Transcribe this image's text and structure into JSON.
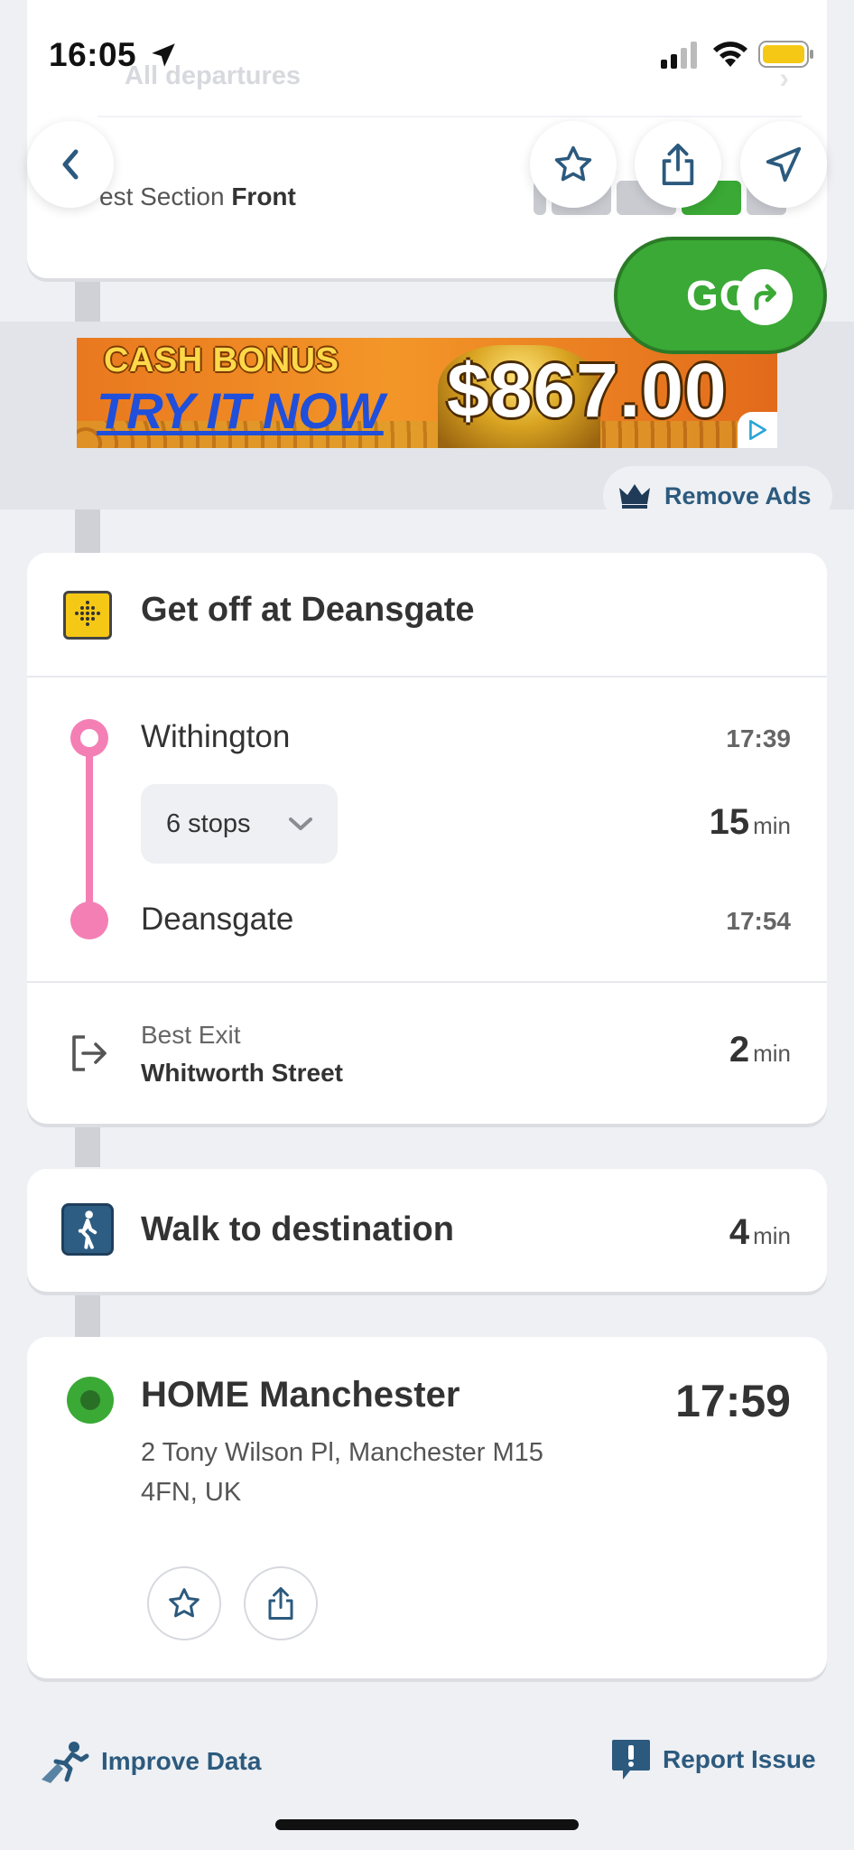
{
  "status_bar": {
    "time": "16:05"
  },
  "top_card": {
    "all_departures": "All departures",
    "best_section_prefix": "est Section",
    "best_section_value": "Front"
  },
  "go_button": {
    "label": "GO"
  },
  "ad": {
    "line1": "CASH BONUS",
    "line2": "TRY IT NOW",
    "amount": "$867.00",
    "remove_label": "Remove Ads"
  },
  "get_off": {
    "title": "Get off at Deansgate",
    "origin": {
      "name": "Withington",
      "time": "17:39"
    },
    "stops_label": "6 stops",
    "duration": "15",
    "duration_unit": "min",
    "destination": {
      "name": "Deansgate",
      "time": "17:54"
    },
    "exit_label": "Best Exit",
    "exit_value": "Whitworth Street",
    "exit_duration": "2",
    "exit_duration_unit": "min"
  },
  "walk": {
    "title": "Walk to destination",
    "duration": "4",
    "duration_unit": "min"
  },
  "destination": {
    "name": "HOME Manchester",
    "time": "17:59",
    "address_line1": "2 Tony Wilson Pl, Manchester M15",
    "address_line2": "4FN, UK"
  },
  "footer": {
    "improve": "Improve Data",
    "report": "Report Issue"
  },
  "colors": {
    "go_green": "#3aa935",
    "tram_line_pink": "#f47fb5",
    "link_blue": "#2c5a7e",
    "tram_icon_yellow": "#f5c816"
  }
}
